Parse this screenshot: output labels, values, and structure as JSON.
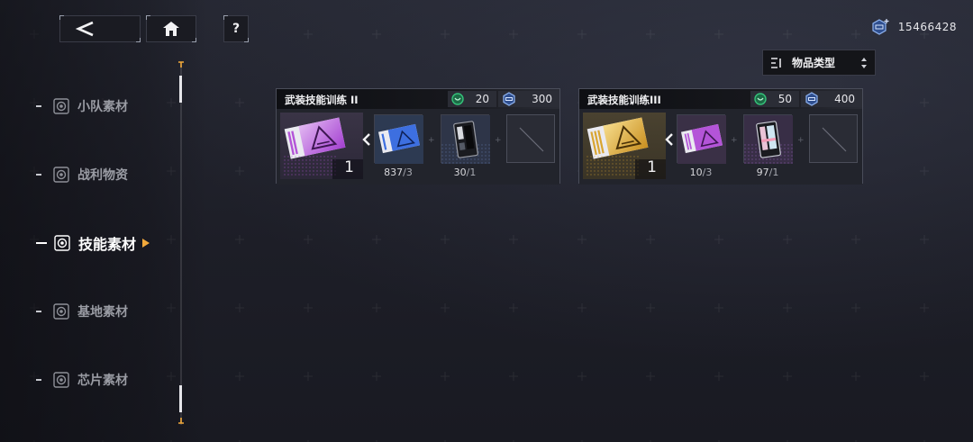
{
  "top": {
    "help_label": "?",
    "currency_value": "15466428"
  },
  "sort": {
    "label": "物品类型"
  },
  "nav": {
    "items": [
      {
        "label": "小队素材",
        "active": false
      },
      {
        "label": "战利物资",
        "active": false
      },
      {
        "label": "技能素材",
        "active": true
      },
      {
        "label": "基地素材",
        "active": false
      },
      {
        "label": "芯片素材",
        "active": false
      }
    ]
  },
  "cards": [
    {
      "title": "武装技能训练 II",
      "cost_a": "20",
      "cost_b": "300",
      "result_qty": "1",
      "materials": [
        {
          "owned": "837",
          "required": "/3"
        },
        {
          "owned": "30",
          "required": "/1"
        }
      ]
    },
    {
      "title": "武装技能训练III",
      "cost_a": "50",
      "cost_b": "400",
      "result_qty": "1",
      "materials": [
        {
          "owned": "10",
          "required": "/3"
        },
        {
          "owned": "97",
          "required": "/1"
        }
      ]
    }
  ],
  "colors": {
    "accent_orange": "#f2a93b",
    "green_currency": "#35c27a",
    "blue_currency": "#4f7fd6",
    "purple_tier": "#b454d8",
    "gold_tier": "#d9a531"
  }
}
